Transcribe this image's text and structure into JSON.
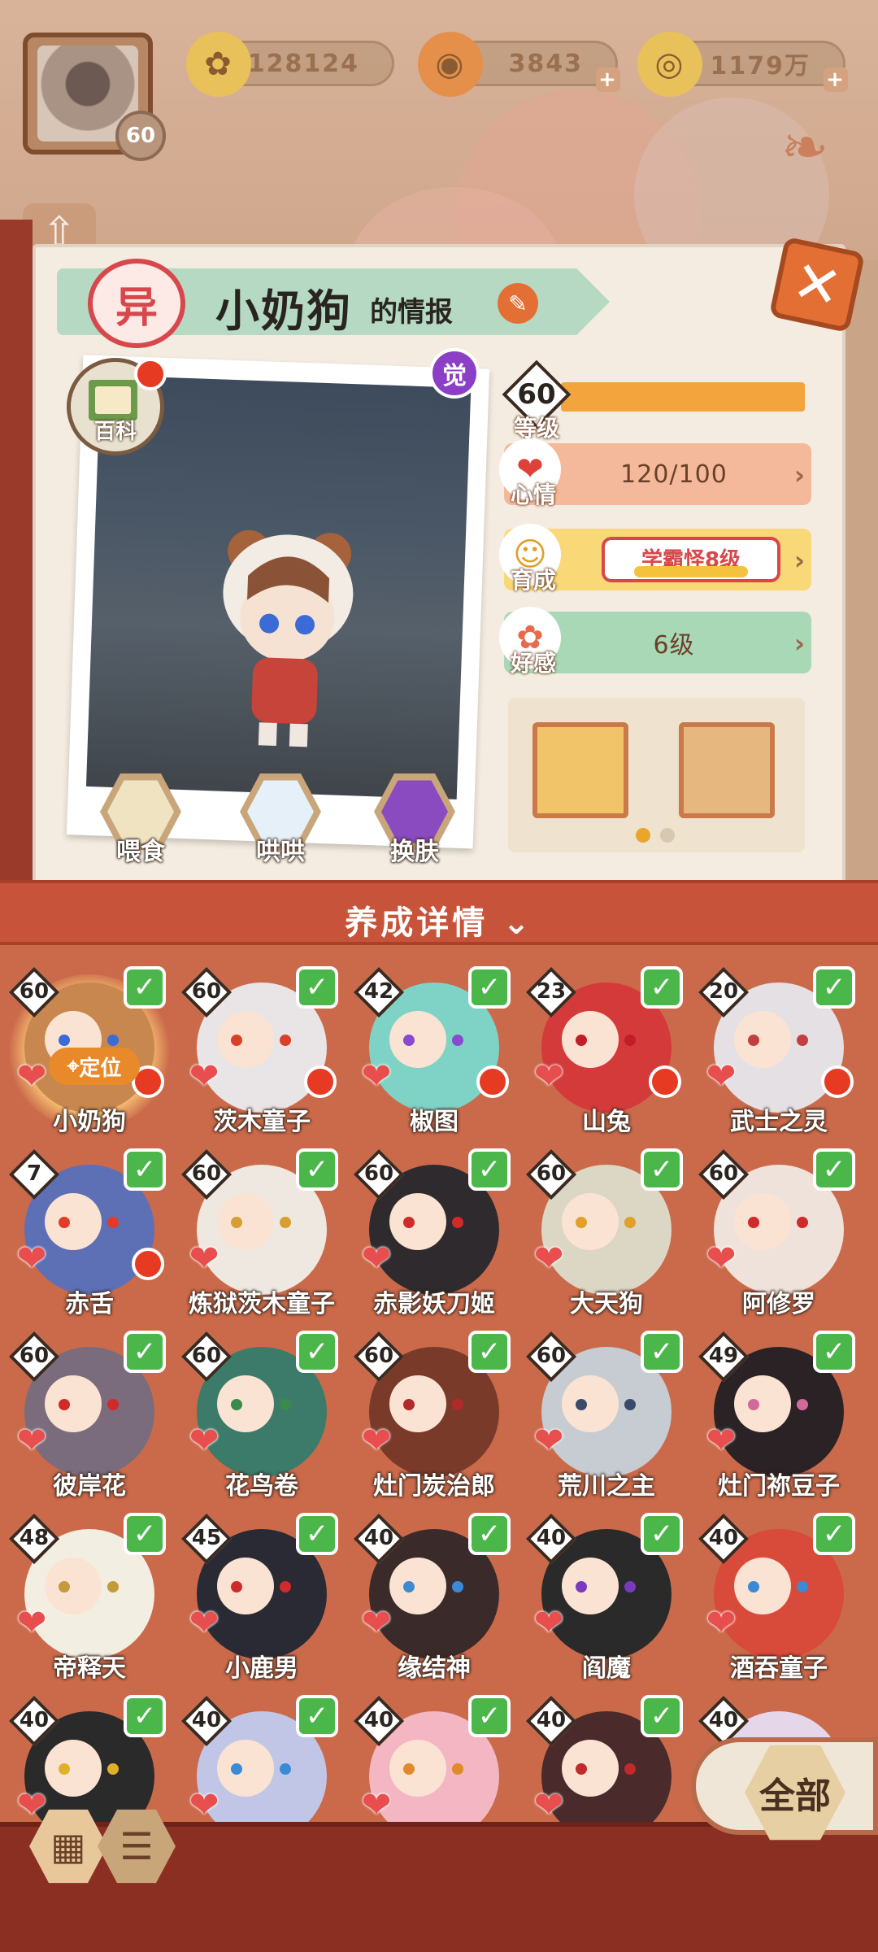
{
  "header": {
    "player_level": "60",
    "resources": [
      {
        "icon": "gold-flower-icon",
        "value": "128124"
      },
      {
        "icon": "red-coin-icon",
        "value": "3843"
      },
      {
        "icon": "gold-coin-icon",
        "value": "1179万"
      }
    ]
  },
  "card": {
    "rank": "异",
    "name": "小奶狗",
    "title_suffix": "的情报",
    "awaken_label": "觉",
    "wiki_label": "百科",
    "actions": [
      {
        "label": "喂食",
        "icon": "noodle-bowl-icon"
      },
      {
        "label": "哄哄",
        "icon": "milk-icon"
      },
      {
        "label": "换肤",
        "icon": "outfit-icon"
      }
    ],
    "stats": {
      "level_value": "60",
      "level_label": "等级",
      "level_progress": 1.0,
      "mood_label": "心情",
      "mood_value": "120/100",
      "growth_label": "育成",
      "growth_value": "学霸怪8级",
      "favor_label": "好感",
      "favor_value": "6级"
    },
    "gift_page_dots": 2,
    "gift_page_current": 1
  },
  "section": {
    "title": "养成详情"
  },
  "characters": [
    {
      "name": "小奶狗",
      "level": "60",
      "checked": true,
      "red_dot": true,
      "selected": true,
      "tag": "定位",
      "color": "#c8874e",
      "eye": "#3b6bd6"
    },
    {
      "name": "茨木童子",
      "level": "60",
      "checked": true,
      "red_dot": true,
      "color": "#e9e4e6",
      "eye": "#d8402a"
    },
    {
      "name": "椒图",
      "level": "42",
      "checked": true,
      "red_dot": true,
      "color": "#7fd3c6",
      "eye": "#8a4ad0"
    },
    {
      "name": "山兔",
      "level": "23",
      "checked": true,
      "red_dot": true,
      "color": "#d43a3a",
      "eye": "#c21d2a"
    },
    {
      "name": "武士之灵",
      "level": "20",
      "checked": true,
      "red_dot": true,
      "color": "#e4e0e4",
      "eye": "#c04040"
    },
    {
      "name": "赤舌",
      "level": "7",
      "checked": true,
      "red_dot": true,
      "color": "#5d6fb5",
      "eye": "#e43a2a"
    },
    {
      "name": "炼狱茨木童子",
      "level": "60",
      "checked": true,
      "red_dot": false,
      "color": "#efe8e0",
      "eye": "#d6a030"
    },
    {
      "name": "赤影妖刀姬",
      "level": "60",
      "checked": true,
      "red_dot": false,
      "color": "#2e2a2e",
      "eye": "#d02a2a"
    },
    {
      "name": "大天狗",
      "level": "60",
      "checked": true,
      "red_dot": false,
      "color": "#dcd6c4",
      "eye": "#e0a02a"
    },
    {
      "name": "阿修罗",
      "level": "60",
      "checked": true,
      "red_dot": false,
      "color": "#efe2da",
      "eye": "#d02a2a"
    },
    {
      "name": "彼岸花",
      "level": "60",
      "checked": true,
      "red_dot": false,
      "color": "#7a6c7c",
      "eye": "#d02a2a"
    },
    {
      "name": "花鸟卷",
      "level": "60",
      "checked": true,
      "red_dot": false,
      "color": "#3c7a6a",
      "eye": "#3a8a4a"
    },
    {
      "name": "灶门炭治郎",
      "level": "60",
      "checked": true,
      "red_dot": false,
      "color": "#7a3a2a",
      "eye": "#b02a2a"
    },
    {
      "name": "荒川之主",
      "level": "60",
      "checked": true,
      "red_dot": false,
      "color": "#c6ccd2",
      "eye": "#3a4a6a"
    },
    {
      "name": "灶门祢豆子",
      "level": "49",
      "checked": true,
      "red_dot": false,
      "color": "#2a2224",
      "eye": "#d06a9a"
    },
    {
      "name": "帝释天",
      "level": "48",
      "checked": true,
      "red_dot": false,
      "color": "#f3eee2",
      "eye": "#c49a3a"
    },
    {
      "name": "小鹿男",
      "level": "45",
      "checked": true,
      "red_dot": false,
      "color": "#2a2a34",
      "eye": "#d02a2a"
    },
    {
      "name": "缘结神",
      "level": "40",
      "checked": true,
      "red_dot": false,
      "color": "#3a2a2a",
      "eye": "#3a8ad6"
    },
    {
      "name": "阎魔",
      "level": "40",
      "checked": true,
      "red_dot": false,
      "color": "#2a2a2a",
      "eye": "#7a3ac0"
    },
    {
      "name": "酒吞童子",
      "level": "40",
      "checked": true,
      "red_dot": false,
      "color": "#d84a3a",
      "eye": "#3a8ad6"
    },
    {
      "name": "",
      "level": "40",
      "checked": true,
      "red_dot": false,
      "color": "#2a2a2a",
      "eye": "#e0b02a"
    },
    {
      "name": "",
      "level": "40",
      "checked": true,
      "red_dot": false,
      "color": "#c2c6e6",
      "eye": "#3a8ad6"
    },
    {
      "name": "",
      "level": "40",
      "checked": true,
      "red_dot": false,
      "color": "#f3b6c2",
      "eye": "#e08a2a"
    },
    {
      "name": "",
      "level": "40",
      "checked": true,
      "red_dot": false,
      "color": "#4a2a2a",
      "eye": "#c02a2a"
    },
    {
      "name": "",
      "level": "40",
      "checked": false,
      "red_dot": false,
      "color": "#e6d6ea",
      "eye": "#6a4ad0"
    }
  ],
  "bottom": {
    "filter_label": "全部",
    "view_icons": [
      "grid-view-icon",
      "list-view-icon"
    ]
  }
}
